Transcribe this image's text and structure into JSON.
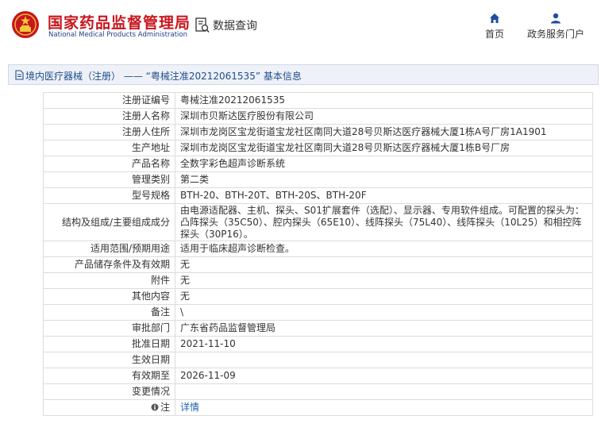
{
  "header": {
    "brand_cn": "国家药品监督管理局",
    "brand_en": "National Medical Products Administration",
    "data_query": "数据查询",
    "nav": [
      {
        "label": "首页",
        "icon": "home-icon"
      },
      {
        "label": "政务服务门户",
        "icon": "user-icon"
      }
    ]
  },
  "breadcrumb": {
    "text": "境内医疗器械（注册） —— “粤械注准20212061535” 基本信息"
  },
  "rows": [
    {
      "label": "注册证编号",
      "value": "粤械注准20212061535"
    },
    {
      "label": "注册人名称",
      "value": "深圳市贝斯达医疗股份有限公司"
    },
    {
      "label": "注册人住所",
      "value": "深圳市龙岗区宝龙街道宝龙社区南同大道28号贝斯达医疗器械大厦1栋A号厂房1A1901"
    },
    {
      "label": "生产地址",
      "value": "深圳市龙岗区宝龙街道宝龙社区南同大道28号贝斯达医疗器械大厦1栋B号厂房"
    },
    {
      "label": "产品名称",
      "value": "全数字彩色超声诊断系统"
    },
    {
      "label": "管理类别",
      "value": "第二类"
    },
    {
      "label": "型号规格",
      "value": "BTH-20、BTH-20T、BTH-20S、BTH-20F"
    },
    {
      "label": "结构及组成/主要组成成分",
      "value": "由电源适配器、主机、探头、S01扩展套件（选配）、显示器、专用软件组成。可配置的探头为：凸阵探头（35C50）、腔内探头（65E10）、线阵探头（75L40）、线阵探头（10L25）和相控阵探头（30P16）。"
    },
    {
      "label": "适用范围/预期用途",
      "value": "适用于临床超声诊断检查。"
    },
    {
      "label": "产品储存条件及有效期",
      "value": "无"
    },
    {
      "label": "附件",
      "value": "无"
    },
    {
      "label": "其他内容",
      "value": "无"
    },
    {
      "label": "备注",
      "value": "\\"
    },
    {
      "label": "审批部门",
      "value": "广东省药品监督管理局"
    },
    {
      "label": "批准日期",
      "value": "2021-11-10"
    },
    {
      "label": "生效日期",
      "value": ""
    },
    {
      "label": "有效期至",
      "value": "2026-11-09"
    },
    {
      "label": "变更情况",
      "value": ""
    },
    {
      "label": "注",
      "value": "详情"
    }
  ],
  "colors": {
    "brand_red": "#c8161d",
    "brand_blue": "#1f3f86",
    "link": "#1f5fb0"
  }
}
